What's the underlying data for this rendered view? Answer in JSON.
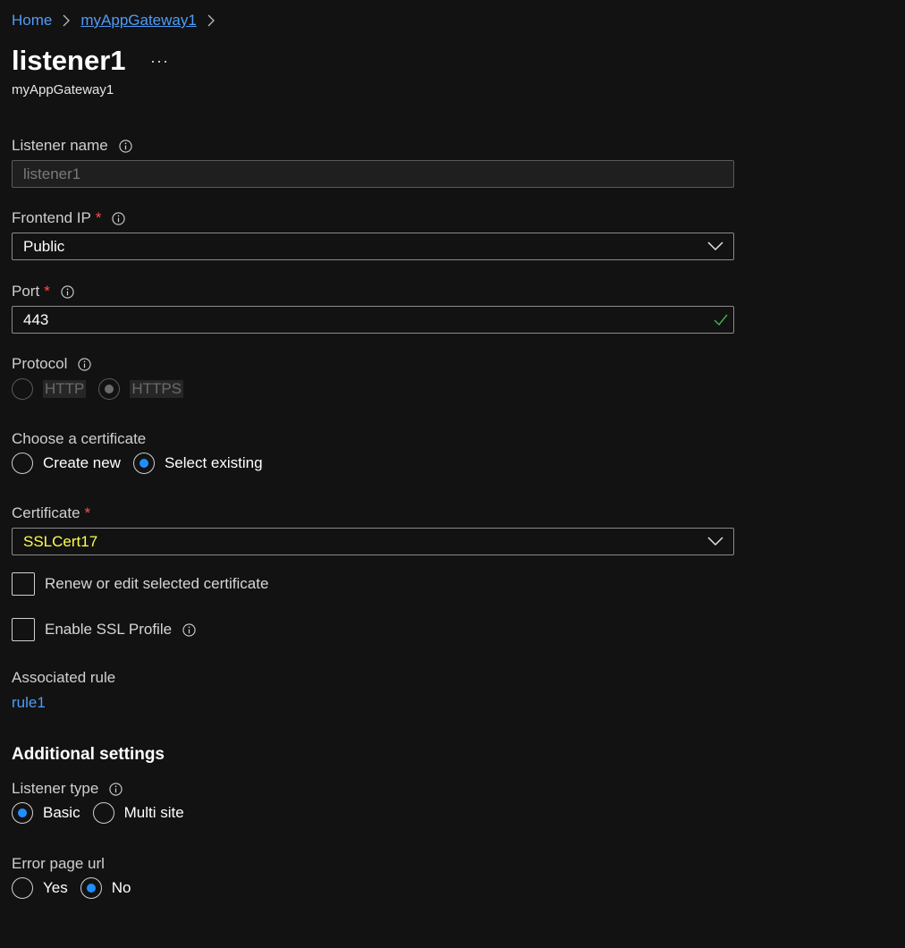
{
  "breadcrumb": {
    "home": "Home",
    "gateway": "myAppGateway1"
  },
  "header": {
    "title": "listener1",
    "more": "···",
    "subtitle": "myAppGateway1"
  },
  "listener_name": {
    "label": "Listener name",
    "value": "listener1"
  },
  "frontend_ip": {
    "label": "Frontend IP",
    "required_mark": "*",
    "value": "Public"
  },
  "port": {
    "label": "Port",
    "required_mark": "*",
    "value": "443"
  },
  "protocol": {
    "label": "Protocol",
    "options": [
      "HTTP",
      "HTTPS"
    ],
    "selected": "HTTPS"
  },
  "certificate_choice": {
    "label": "Choose a certificate",
    "options": [
      "Create new",
      "Select existing"
    ],
    "selected": "Select existing"
  },
  "certificate": {
    "label": "Certificate",
    "required_mark": "*",
    "value": "SSLCert17"
  },
  "renew_checkbox": {
    "label": "Renew or edit selected certificate",
    "checked": false
  },
  "ssl_profile_checkbox": {
    "label": "Enable SSL Profile",
    "checked": false
  },
  "associated_rule": {
    "label": "Associated rule",
    "value": "rule1"
  },
  "additional_settings": {
    "title": "Additional settings"
  },
  "listener_type": {
    "label": "Listener type",
    "options": [
      "Basic",
      "Multi site"
    ],
    "selected": "Basic"
  },
  "error_page_url": {
    "label": "Error page url",
    "options": [
      "Yes",
      "No"
    ],
    "selected": "No"
  },
  "colors": {
    "background": "#121212",
    "link": "#4f9cf9",
    "radio_selected": "#1f8fff",
    "required": "#ff4d4d",
    "certificate_value": "#ffff4d",
    "valid_check": "#4caf50"
  }
}
